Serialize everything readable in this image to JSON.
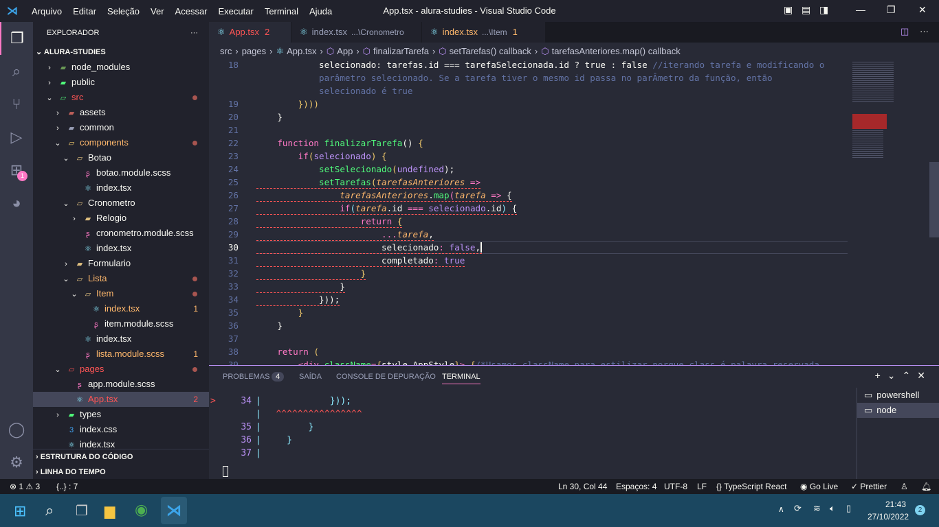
{
  "titlebar": {
    "menu": [
      "Arquivo",
      "Editar",
      "Seleção",
      "Ver",
      "Acessar",
      "Executar",
      "Terminal",
      "Ajuda"
    ],
    "title": "App.tsx - alura-studies - Visual Studio Code"
  },
  "activity": {
    "extensions_badge": "1"
  },
  "sidebar": {
    "header": "EXPLORADOR",
    "more": "···",
    "root": "ALURA-STUDIES",
    "items": [
      {
        "label": "node_modules",
        "depth": 1,
        "type": "folder",
        "color": "#f8f8f2",
        "icon": "#6a9955"
      },
      {
        "label": "public",
        "depth": 1,
        "type": "folder",
        "color": "#f8f8f2",
        "icon": "#50fa7b"
      },
      {
        "label": "src",
        "depth": 1,
        "type": "folder-open",
        "color": "#ff5555",
        "icon": "#50fa7b",
        "dot": true
      },
      {
        "label": "assets",
        "depth": 2,
        "type": "folder",
        "color": "#f8f8f2",
        "icon": "#c0605a"
      },
      {
        "label": "common",
        "depth": 2,
        "type": "folder",
        "color": "#f8f8f2",
        "icon": "#9aa0b8"
      },
      {
        "label": "components",
        "depth": 2,
        "type": "folder-open",
        "color": "#ffb86c",
        "icon": "#f1c96b",
        "dot": true
      },
      {
        "label": "Botao",
        "depth": 3,
        "type": "folder-open",
        "color": "#f8f8f2",
        "icon": "#e0c080"
      },
      {
        "label": "botao.module.scss",
        "depth": 4,
        "type": "scss",
        "color": "#f8f8f2",
        "icon": "#ff79c6"
      },
      {
        "label": "index.tsx",
        "depth": 4,
        "type": "react",
        "color": "#f8f8f2",
        "icon": "#8be9fd"
      },
      {
        "label": "Cronometro",
        "depth": 3,
        "type": "folder-open",
        "color": "#f8f8f2",
        "icon": "#e0c080"
      },
      {
        "label": "Relogio",
        "depth": 4,
        "type": "folder",
        "color": "#f8f8f2",
        "icon": "#e0c080"
      },
      {
        "label": "cronometro.module.scss",
        "depth": 4,
        "type": "scss",
        "color": "#f8f8f2",
        "icon": "#ff79c6"
      },
      {
        "label": "index.tsx",
        "depth": 4,
        "type": "react",
        "color": "#f8f8f2",
        "icon": "#8be9fd"
      },
      {
        "label": "Formulario",
        "depth": 3,
        "type": "folder",
        "color": "#f8f8f2",
        "icon": "#e0c080"
      },
      {
        "label": "Lista",
        "depth": 3,
        "type": "folder-open",
        "color": "#ffb86c",
        "icon": "#e0c080",
        "dot": true
      },
      {
        "label": "Item",
        "depth": 4,
        "type": "folder-open",
        "color": "#ffb86c",
        "icon": "#e0c080",
        "dot": true
      },
      {
        "label": "index.tsx",
        "depth": 5,
        "type": "react",
        "color": "#ffb86c",
        "icon": "#8be9fd",
        "badge": "1"
      },
      {
        "label": "item.module.scss",
        "depth": 5,
        "type": "scss",
        "color": "#f8f8f2",
        "icon": "#ff79c6"
      },
      {
        "label": "index.tsx",
        "depth": 4,
        "type": "react",
        "color": "#f8f8f2",
        "icon": "#8be9fd"
      },
      {
        "label": "lista.module.scss",
        "depth": 4,
        "type": "scss",
        "color": "#ffb86c",
        "icon": "#ff79c6",
        "badge": "1"
      },
      {
        "label": "pages",
        "depth": 2,
        "type": "folder-open",
        "color": "#ff5555",
        "icon": "#ff5555",
        "dot": true
      },
      {
        "label": "app.module.scss",
        "depth": 3,
        "type": "scss",
        "color": "#f8f8f2",
        "icon": "#ff79c6"
      },
      {
        "label": "App.tsx",
        "depth": 3,
        "type": "react",
        "color": "#ff5555",
        "icon": "#8be9fd",
        "badge": "2",
        "selected": true
      },
      {
        "label": "types",
        "depth": 2,
        "type": "folder",
        "color": "#f8f8f2",
        "icon": "#50fa7b"
      },
      {
        "label": "index.css",
        "depth": 2,
        "type": "css",
        "color": "#f8f8f2",
        "icon": "#42a5f5"
      },
      {
        "label": "index.tsx",
        "depth": 2,
        "type": "react",
        "color": "#f8f8f2",
        "icon": "#8be9fd"
      }
    ],
    "sections": [
      "ESTRUTURA DO CÓDIGO",
      "LINHA DO TEMPO"
    ]
  },
  "tabs": [
    {
      "label": "App.tsx",
      "badge": "2",
      "active": true
    },
    {
      "label": "index.tsx",
      "path": "...\\Cronometro"
    },
    {
      "label": "index.tsx",
      "path": "...\\Item",
      "badge": "1"
    }
  ],
  "breadcrumbs": [
    "src",
    "pages",
    "App.tsx",
    "App",
    "finalizarTarefa",
    "setTarefas() callback",
    "tarefasAnteriores.map() callback"
  ],
  "editor": {
    "current_line": 30,
    "lines": [
      {
        "n": "18",
        "t": [
          [
            "            selecionado: tarefas.id === tarefaSelecionada.id ? true : false ",
            "w"
          ],
          [
            "//iterando tarefa e modificando o",
            "c"
          ]
        ]
      },
      {
        "n": "",
        "t": [
          [
            "            parâmetro selecionado. Se a tarefa tiver o mesmo id passa no parÂmetro da função, então",
            "c"
          ]
        ]
      },
      {
        "n": "",
        "t": [
          [
            "            selecionado é true",
            "c"
          ]
        ]
      },
      {
        "n": "19",
        "t": [
          [
            "        ",
            "w"
          ],
          [
            "})))",
            "b"
          ]
        ]
      },
      {
        "n": "20",
        "t": [
          [
            "    }",
            "w"
          ]
        ]
      },
      {
        "n": "21",
        "t": [
          [
            "",
            "w"
          ]
        ]
      },
      {
        "n": "22",
        "t": [
          [
            "    ",
            "w"
          ],
          [
            "function ",
            "k"
          ],
          [
            "finalizarTarefa",
            "f"
          ],
          [
            "() ",
            "w"
          ],
          [
            "{",
            "b"
          ]
        ]
      },
      {
        "n": "23",
        "t": [
          [
            "        ",
            "w"
          ],
          [
            "if",
            "k"
          ],
          [
            "(",
            "b"
          ],
          [
            "selecionado",
            "p"
          ],
          [
            ") ",
            "b"
          ],
          [
            "{",
            "b"
          ]
        ]
      },
      {
        "n": "24",
        "t": [
          [
            "            ",
            "w"
          ],
          [
            "setSelecionado",
            "f"
          ],
          [
            "(",
            "b"
          ],
          [
            "undefined",
            "p"
          ],
          [
            ");",
            "w"
          ]
        ]
      },
      {
        "n": "25",
        "t": [
          [
            "            ",
            "w"
          ],
          [
            "setTarefas",
            "f"
          ],
          [
            "(",
            "b"
          ],
          [
            "tarefasAnteriores",
            "y"
          ],
          [
            " =>",
            "k"
          ]
        ],
        "sq": true
      },
      {
        "n": "26",
        "t": [
          [
            "                ",
            "w"
          ],
          [
            "tarefasAnteriores",
            "y"
          ],
          [
            ".",
            "w"
          ],
          [
            "map",
            "f"
          ],
          [
            "(",
            "k"
          ],
          [
            "tarefa",
            "y"
          ],
          [
            " => ",
            "k"
          ],
          [
            "{",
            "w"
          ]
        ],
        "sq": true
      },
      {
        "n": "27",
        "t": [
          [
            "                ",
            "w"
          ],
          [
            "if",
            "k"
          ],
          [
            "(",
            "g"
          ],
          [
            "tarefa",
            "y"
          ],
          [
            ".id ",
            "w"
          ],
          [
            "=== ",
            "k"
          ],
          [
            "selecionado",
            "p"
          ],
          [
            ".id",
            "w"
          ],
          [
            ") ",
            "g"
          ],
          [
            "{",
            "w"
          ]
        ],
        "sq": true
      },
      {
        "n": "28",
        "t": [
          [
            "                    ",
            "w"
          ],
          [
            "return ",
            "k"
          ],
          [
            "{",
            "b"
          ]
        ],
        "sq": true
      },
      {
        "n": "29",
        "t": [
          [
            "                        ",
            "w"
          ],
          [
            "...",
            "k"
          ],
          [
            "tarefa",
            "y"
          ],
          [
            ",",
            "w"
          ]
        ],
        "sq": true
      },
      {
        "n": "30",
        "t": [
          [
            "                        selecionado",
            "w"
          ],
          [
            ": ",
            "k"
          ],
          [
            "false",
            "p"
          ],
          [
            ",",
            "w"
          ]
        ],
        "sq": true
      },
      {
        "n": "31",
        "t": [
          [
            "                        completado",
            "w"
          ],
          [
            ": ",
            "k"
          ],
          [
            "true",
            "p"
          ]
        ],
        "sq": true
      },
      {
        "n": "32",
        "t": [
          [
            "                    ",
            "w"
          ],
          [
            "}",
            "b"
          ]
        ],
        "sq": true
      },
      {
        "n": "33",
        "t": [
          [
            "                ",
            "w"
          ],
          [
            "}",
            "w"
          ]
        ],
        "sq": true
      },
      {
        "n": "34",
        "t": [
          [
            "            ",
            "w"
          ],
          [
            "})",
            "w"
          ],
          [
            ");",
            "w"
          ]
        ],
        "sq": true
      },
      {
        "n": "35",
        "t": [
          [
            "        ",
            "w"
          ],
          [
            "}",
            "b"
          ]
        ]
      },
      {
        "n": "36",
        "t": [
          [
            "    }",
            "w"
          ]
        ]
      },
      {
        "n": "37",
        "t": [
          [
            "",
            "w"
          ]
        ]
      },
      {
        "n": "38",
        "t": [
          [
            "    ",
            "w"
          ],
          [
            "return ",
            "k"
          ],
          [
            "(",
            "b"
          ]
        ]
      },
      {
        "n": "39",
        "t": [
          [
            "        ",
            "w"
          ],
          [
            "<div ",
            "k"
          ],
          [
            "className",
            "f"
          ],
          [
            "=",
            "k"
          ],
          [
            "{",
            "b"
          ],
          [
            "style.AppStyle",
            "w"
          ],
          [
            "}",
            "b"
          ],
          [
            "> ",
            "k"
          ],
          [
            "{",
            "b"
          ],
          [
            "/*Usamos className para estilizar porque class é palavra reservada",
            "c"
          ]
        ]
      }
    ]
  },
  "panel": {
    "tabs": [
      "PROBLEMAS",
      "SAÍDA",
      "CONSOLE DE DEPURAÇÃO",
      "TERMINAL"
    ],
    "problems_count": "4",
    "active": "TERMINAL",
    "terminal_lines": [
      {
        "n": "34",
        "t": "            }));",
        "err": true
      },
      {
        "n": "",
        "t": "  ^^^^^^^^^^^^^^^^",
        "carets": true
      },
      {
        "n": "35",
        "t": "        }"
      },
      {
        "n": "36",
        "t": "    }"
      },
      {
        "n": "37",
        "t": ""
      }
    ],
    "terminals": [
      "powershell",
      "node"
    ]
  },
  "status": {
    "errors": "1",
    "warnings": "3",
    "braces": "{..} : 7",
    "position": "Ln 30, Col 44",
    "spaces": "Espaços: 4",
    "encoding": "UTF-8",
    "eol": "LF",
    "language": "TypeScript React",
    "golive": "Go Live",
    "prettier": "Prettier"
  },
  "taskbar": {
    "time": "21:43",
    "date": "27/10/2022",
    "notifications": "2"
  }
}
